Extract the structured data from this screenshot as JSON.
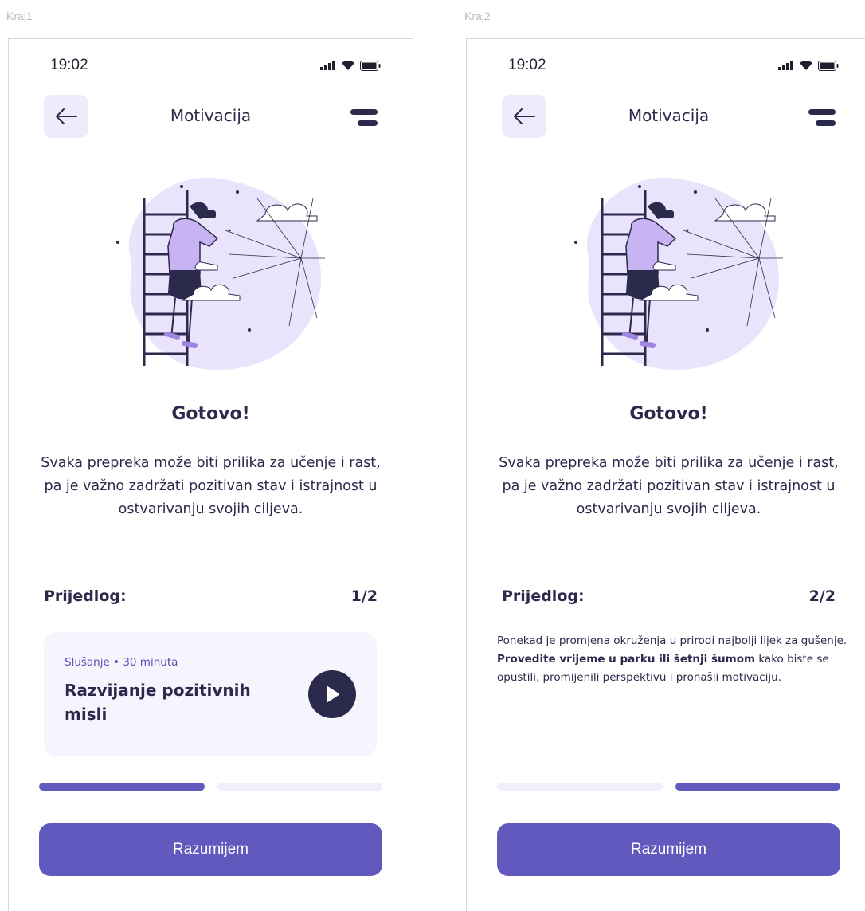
{
  "frames": [
    {
      "label": "Kraj1",
      "status_time": "19:02",
      "nav_title": "Motivacija",
      "done_title": "Gotovo!",
      "body_text": "Svaka prepreka može biti prilika za učenje i rast, pa je važno zadržati pozitivan stav i istrajnost u ostvarivanju svojih ciljeva.",
      "suggestion_label": "Prijedlog:",
      "suggestion_count": "1/2",
      "card": {
        "meta": "Slušanje • 30 minuta",
        "title": "Razvijanje pozitivnih misli"
      },
      "progress": [
        1,
        0
      ],
      "cta_label": "Razumijem"
    },
    {
      "label": "Kraj2",
      "status_time": "19:02",
      "nav_title": "Motivacija",
      "done_title": "Gotovo!",
      "body_text": "Svaka prepreka može biti prilika za učenje i rast, pa je važno zadržati pozitivan stav i istrajnost u ostvarivanju svojih ciljeva.",
      "suggestion_label": "Prijedlog:",
      "suggestion_count": "2/2",
      "suggestion_text": {
        "part1": "Ponekad je promjena okruženja u prirodi najbolji lijek za gušenje. ",
        "bold": "Provedite vrijeme u parku ili šetnji šumom",
        "part2": " kako biste se opustili, promijenili perspektivu i pronašli motivaciju."
      },
      "progress": [
        0,
        1
      ],
      "cta_label": "Razumijem"
    }
  ],
  "colors": {
    "primary": "#6259be",
    "dark": "#2b2a4c",
    "light_purple": "#eeebfb",
    "card_bg": "#f6f4fd",
    "track": "#f0eefb",
    "blob": "#e9e3fb"
  },
  "icons": {
    "back": "arrow-left-icon",
    "menu": "menu-icon",
    "play": "play-icon",
    "signal": "signal-icon",
    "wifi": "wifi-icon",
    "battery": "battery-icon"
  }
}
